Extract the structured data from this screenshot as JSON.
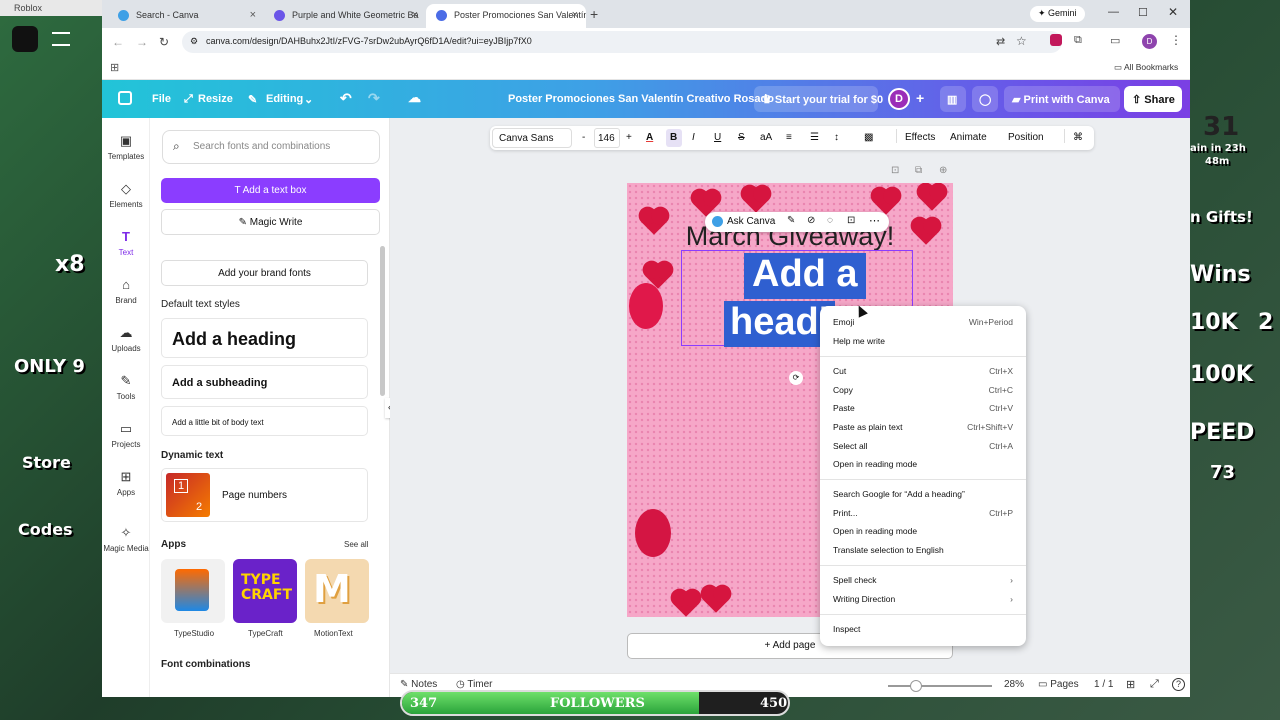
{
  "roblox_window_title": "Roblox",
  "game_overlay": {
    "left_texts": [
      "x8",
      "ONLY 9",
      "Store",
      "Codes"
    ],
    "right_texts": [
      "31",
      "ain in 23h",
      "48m",
      "n Gifts!",
      "Wins",
      "10K",
      "2",
      "100K",
      "PEED",
      "73"
    ],
    "followers_goal": {
      "label": "FOLLOWERS",
      "current": "347",
      "target": "450",
      "progress": 0.77
    }
  },
  "browser": {
    "tabs": [
      {
        "title": "Search - Canva",
        "active": false
      },
      {
        "title": "Purple and White Geometric Ba",
        "active": false
      },
      {
        "title": "Poster Promociones San Valentín",
        "active": true
      }
    ],
    "gemini_label": "Gemini",
    "url": "canva.com/design/DAHBuhx2JtI/zFVG-7srDw2ubAyrQ6fD1A/edit?ui=eyJBIjp7fX0",
    "profile_initial": "D",
    "bookmarks_label": "All Bookmarks"
  },
  "canva_header": {
    "file": "File",
    "resize": "Resize",
    "editing": "Editing",
    "doc_title": "Poster Promociones San Valentín Creativo Rosado",
    "trial": "Start your trial for $0",
    "avatar": "D",
    "print": "Print with Canva",
    "share": "Share"
  },
  "rail": {
    "items": [
      "Templates",
      "Elements",
      "Text",
      "Brand",
      "Uploads",
      "Tools",
      "Projects",
      "Apps",
      "Magic Media"
    ]
  },
  "text_panel": {
    "search_placeholder": "Search fonts and combinations",
    "add_text_box": "Add a text box",
    "magic_write": "Magic Write",
    "brand_fonts": "Add your brand fonts",
    "default_styles_title": "Default text styles",
    "heading": "Add a heading",
    "subheading": "Add a subheading",
    "body": "Add a little bit of body text",
    "dynamic_title": "Dynamic text",
    "page_numbers": "Page numbers",
    "page_thumb_numbers": [
      "1",
      "2"
    ],
    "apps_title": "Apps",
    "see_all": "See all",
    "apps": [
      {
        "name": "TypeStudio",
        "color": "#f1f1f1"
      },
      {
        "name": "TypeCraft",
        "color": "#6a22c9"
      },
      {
        "name": "MotionText",
        "color": "#f4d9b0"
      }
    ],
    "font_combinations_title": "Font combinations"
  },
  "text_toolbar": {
    "font": "Canva Sans",
    "minus": "-",
    "size": "146",
    "plus": "+",
    "effects": "Effects",
    "animate": "Animate",
    "position": "Position"
  },
  "poster": {
    "top_text": "March Giveaway!",
    "heading_line1": "Add a",
    "heading_line2": "headi",
    "ask_canva": "Ask Canva"
  },
  "context_menu": {
    "groups": [
      [
        {
          "label": "Emoji",
          "shortcut": "Win+Period"
        },
        {
          "label": "Help me write",
          "shortcut": ""
        }
      ],
      [
        {
          "label": "Cut",
          "shortcut": "Ctrl+X"
        },
        {
          "label": "Copy",
          "shortcut": "Ctrl+C"
        },
        {
          "label": "Paste",
          "shortcut": "Ctrl+V"
        },
        {
          "label": "Paste as plain text",
          "shortcut": "Ctrl+Shift+V"
        },
        {
          "label": "Select all",
          "shortcut": "Ctrl+A"
        },
        {
          "label": "Open in reading mode",
          "shortcut": ""
        }
      ],
      [
        {
          "label": "Search Google for “Add a heading”",
          "shortcut": ""
        },
        {
          "label": "Print...",
          "shortcut": "Ctrl+P"
        },
        {
          "label": "Open in reading mode",
          "shortcut": ""
        },
        {
          "label": "Translate selection to English",
          "shortcut": ""
        }
      ],
      [
        {
          "label": "Spell check",
          "shortcut": "›"
        },
        {
          "label": "Writing Direction",
          "shortcut": "›"
        }
      ],
      [
        {
          "label": "Inspect",
          "shortcut": ""
        }
      ]
    ]
  },
  "add_page": "+ Add page",
  "bottom_bar": {
    "notes": "Notes",
    "timer": "Timer",
    "zoom": "28%",
    "pages": "Pages",
    "page_count": "1 / 1"
  },
  "colors": {
    "canva_purple": "#8b3dff",
    "selection_blue": "#2f5fd0",
    "poster_pink": "#f6a7c8",
    "heart_red": "#d6153f"
  }
}
